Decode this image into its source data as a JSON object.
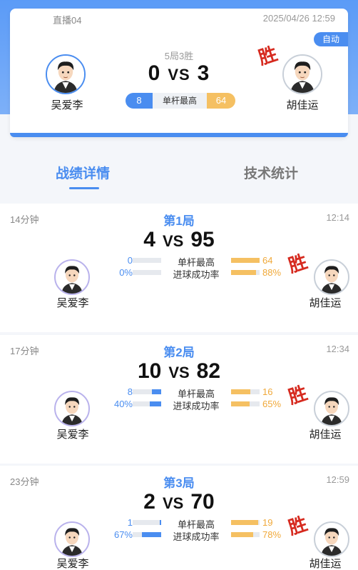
{
  "header": {
    "channel": "直播04",
    "datetime": "2025/04/26 12:59",
    "mode_badge": "自动",
    "format": "5局3胜",
    "score_left": "0",
    "score_right": "3",
    "vs": "VS",
    "stat_left": "8",
    "stat_label": "单杆最高",
    "stat_right": "64",
    "win_stamp": "胜",
    "player_left": "吴爱李",
    "player_right": "胡佳运"
  },
  "tabs": [
    {
      "label": "战绩详情",
      "active": true
    },
    {
      "label": "技术统计",
      "active": false
    }
  ],
  "games": [
    {
      "duration": "14分钟",
      "title": "第1局",
      "time": "12:14",
      "score_left": "4",
      "score_right": "95",
      "vs": "VS",
      "win_stamp": "胜",
      "player_left": "吴爱李",
      "player_right": "胡佳运",
      "stats": [
        {
          "left": "0",
          "label": "单杆最高",
          "right": "64",
          "left_frac": 0.0,
          "right_frac": 1.0
        },
        {
          "left": "0%",
          "label": "进球成功率",
          "right": "88%",
          "left_frac": 0.0,
          "right_frac": 0.88
        }
      ]
    },
    {
      "duration": "17分钟",
      "title": "第2局",
      "time": "12:34",
      "score_left": "10",
      "score_right": "82",
      "vs": "VS",
      "win_stamp": "胜",
      "player_left": "吴爱李",
      "player_right": "胡佳运",
      "stats": [
        {
          "left": "8",
          "label": "单杆最高",
          "right": "16",
          "left_frac": 0.33,
          "right_frac": 0.67
        },
        {
          "left": "40%",
          "label": "进球成功率",
          "right": "65%",
          "left_frac": 0.4,
          "right_frac": 0.65
        }
      ]
    },
    {
      "duration": "23分钟",
      "title": "第3局",
      "time": "12:59",
      "score_left": "2",
      "score_right": "70",
      "vs": "VS",
      "win_stamp": "胜",
      "player_left": "吴爱李",
      "player_right": "胡佳运",
      "stats": [
        {
          "left": "1",
          "label": "单杆最高",
          "right": "19",
          "left_frac": 0.05,
          "right_frac": 0.95
        },
        {
          "left": "67%",
          "label": "进球成功率",
          "right": "78%",
          "left_frac": 0.67,
          "right_frac": 0.78
        }
      ]
    }
  ],
  "colors": {
    "accent": "#4a8df0",
    "secondary": "#f5c062",
    "win": "#d62a1f"
  }
}
